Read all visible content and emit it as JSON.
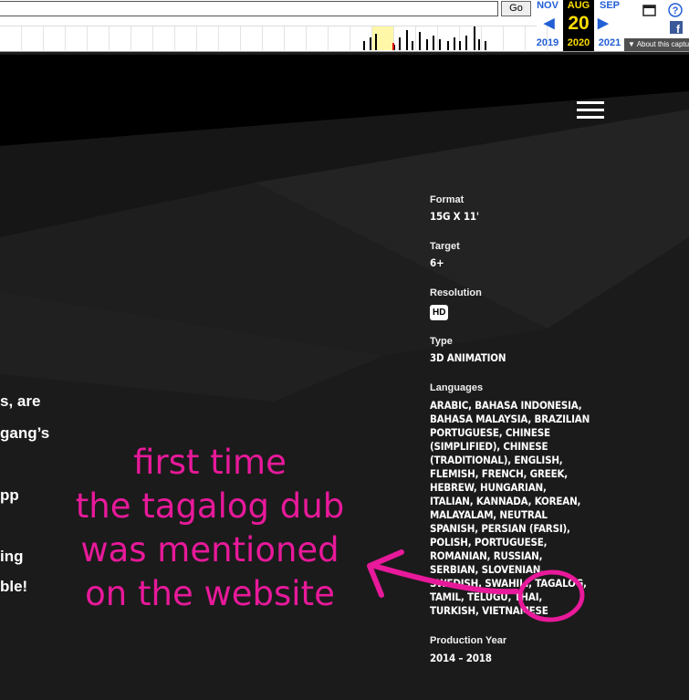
{
  "wayback": {
    "go_label": "Go",
    "prev": {
      "month": "NOV",
      "year": "2019"
    },
    "current": {
      "month": "AUG",
      "day": "20",
      "year": "2020"
    },
    "next": {
      "month": "SEP",
      "year": "2021"
    },
    "about_label": "▼ About this capture"
  },
  "details": {
    "format": {
      "label": "Format",
      "value": "15G X 11'"
    },
    "target": {
      "label": "Target",
      "value": "6+"
    },
    "resolution": {
      "label": "Resolution",
      "value": "HD"
    },
    "type": {
      "label": "Type",
      "value": "3D ANIMATION"
    },
    "languages": {
      "label": "Languages",
      "lines": [
        "ARABIC, BAHASA INDONESIA,",
        "BAHASA MALAYSIA, BRAZILIAN",
        "PORTUGUESE, CHINESE",
        "(SIMPLIFIED), CHINESE",
        "(TRADITIONAL), ENGLISH,",
        "FLEMISH, FRENCH, GREEK,",
        "HEBREW, HUNGARIAN,",
        "ITALIAN, KANNADA, KOREAN,",
        "MALAYALAM, NEUTRAL",
        "SPANISH, PERSIAN (FARSI),",
        "POLISH, PORTUGUESE,",
        "ROMANIAN, RUSSIAN,",
        "SERBIAN, SLOVENIAN,",
        "SWEDISH, SWAHILI, TAGALOG,",
        "TAMIL, TELUGU, THAI,",
        "TURKISH, VIETNAMESE"
      ]
    },
    "production_year": {
      "label": "Production Year",
      "value": "2014 – 2018"
    }
  },
  "left_text": [
    "s, are",
    "gang’s",
    "pp",
    "ing",
    "ble!"
  ],
  "annotation": [
    "first time",
    "the tagalog dub",
    "was mentioned",
    "on the website"
  ],
  "colors": {
    "annotation": "#e8199a",
    "background": "#1b1b1b",
    "wayback_accent": "#225fd6",
    "wayback_current": "#ffdd00"
  }
}
